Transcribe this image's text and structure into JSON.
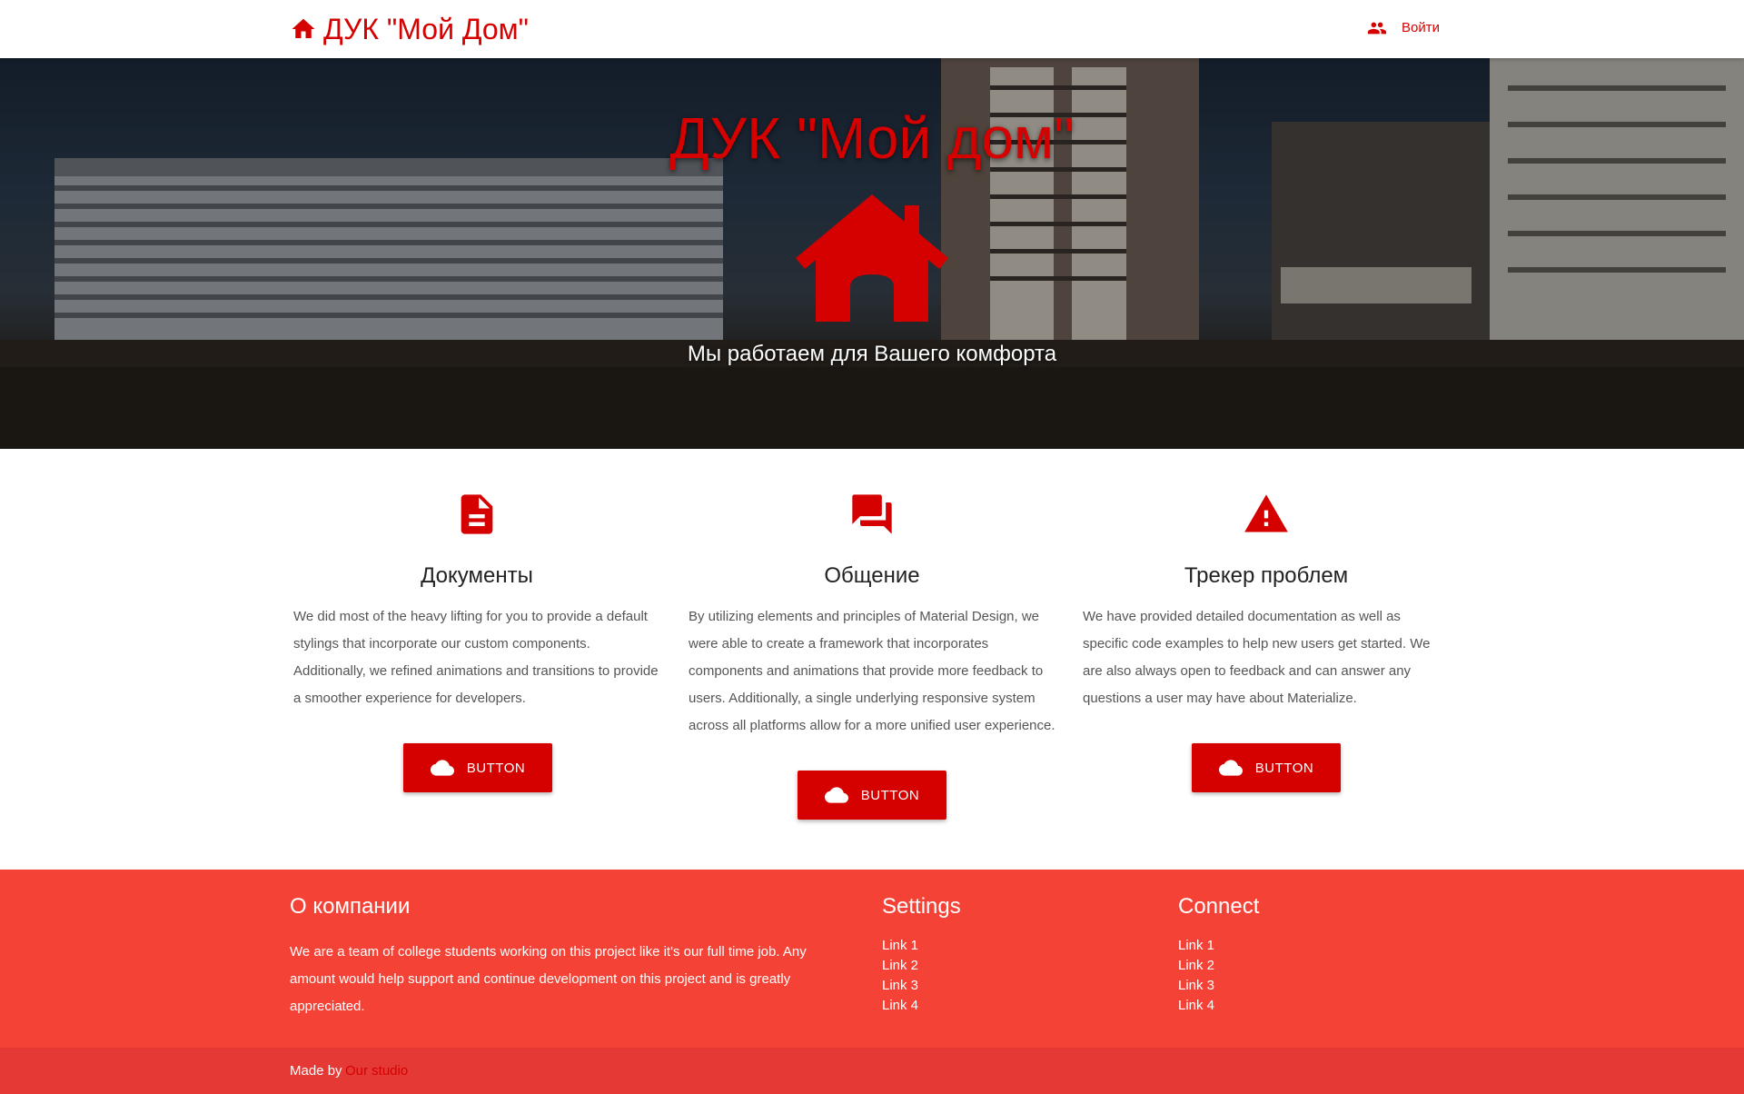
{
  "nav": {
    "brand": "ДУК \"Мой Дом\"",
    "login": "Войти",
    "brand_icon": "home-icon",
    "login_icon": "people-icon"
  },
  "hero": {
    "title": "ДУК \"Мой дом\"",
    "subtitle": "Мы работаем для Вашего комфорта",
    "icon": "house-icon"
  },
  "features": [
    {
      "icon": "document-icon",
      "title": "Документы",
      "text": "We did most of the heavy lifting for you to provide a default stylings that incorporate our custom components. Additionally, we refined animations and transitions to provide a smoother experience for developers.",
      "button": "BUTTON"
    },
    {
      "icon": "chat-icon",
      "title": "Общение",
      "text": "By utilizing elements and principles of Material Design, we were able to create a framework that incorporates components and animations that provide more feedback to users. Additionally, a single underlying responsive system across all platforms allow for a more unified user experience.",
      "button": "BUTTON"
    },
    {
      "icon": "warning-icon",
      "title": "Трекер проблем",
      "text": "We have provided detailed documentation as well as specific code examples to help new users get started. We are also always open to feedback and can answer any questions a user may have about Materialize.",
      "button": "BUTTON"
    }
  ],
  "footer": {
    "about_title": "О компании",
    "about_text": "We are a team of college students working on this project like it's our full time job. Any amount would help support and continue development on this project and is greatly appreciated.",
    "settings_title": "Settings",
    "settings_links": [
      "Link 1",
      "Link 2",
      "Link 3",
      "Link 4"
    ],
    "connect_title": "Connect",
    "connect_links": [
      "Link 1",
      "Link 2",
      "Link 3",
      "Link 4"
    ],
    "made_by": "Made by",
    "studio": "Our studio"
  },
  "colors": {
    "accent": "#d50000",
    "footer_bg": "#f44336",
    "footer_bottom_bg": "#e53935"
  }
}
